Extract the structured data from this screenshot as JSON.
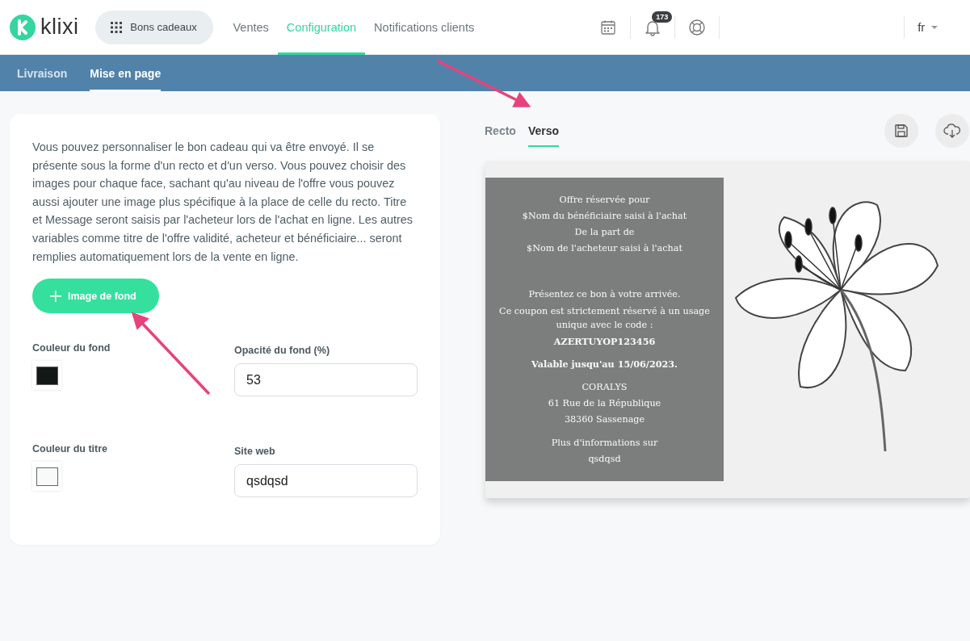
{
  "header": {
    "logo": "klixi",
    "app_switcher": "Bons cadeaux",
    "nav": [
      {
        "label": "Ventes",
        "selected": false
      },
      {
        "label": "Configuration",
        "selected": true
      },
      {
        "label": "Notifications clients",
        "selected": false
      }
    ],
    "notification_count": "173",
    "language": "fr"
  },
  "subnav": [
    {
      "label": "Livraison",
      "selected": false
    },
    {
      "label": "Mise en page",
      "selected": true
    }
  ],
  "settings": {
    "description": "Vous pouvez personnaliser le bon cadeau qui va être envoyé. Il se présente sous la forme d'un recto et d'un verso. Vous pouvez choisir des images pour chaque face, sachant qu'au niveau de l'offre vous pouvez aussi ajouter une image plus spécifique à la place de celle du recto. Titre et Message seront saisis par l'acheteur lors de l'achat en ligne. Les autres variables comme titre de l'offre validité, acheteur et bénéficiaire... seront remplies automatiquement lors de la vente en ligne.",
    "add_button": "Image de fond",
    "fields": [
      {
        "kind": "color",
        "label": "Couleur du fond",
        "color": "#141816"
      },
      {
        "kind": "input",
        "label": "Opacité du fond (%)",
        "value": "53"
      },
      {
        "kind": "color",
        "label": "Couleur du titre",
        "color": "#f8fafa"
      },
      {
        "kind": "input",
        "label": "Site web",
        "value": "qsdqsd"
      }
    ]
  },
  "preview": {
    "tabs": [
      {
        "label": "Recto",
        "selected": false
      },
      {
        "label": "Verso",
        "selected": true
      }
    ],
    "blocks": [
      [
        {
          "text": "Offre réservée pour",
          "bold": false
        },
        {
          "text": "$Nom du bénéficiaire saisi à l'achat",
          "bold": false
        },
        {
          "text": "De la part de",
          "bold": false
        },
        {
          "text": "$Nom de l'acheteur saisi à l'achat",
          "bold": false
        }
      ],
      [
        {
          "text": "Présentez ce bon à votre arrivée.",
          "bold": false
        },
        {
          "text": "Ce coupon est strictement réservé à un usage unique avec le code :",
          "bold": false
        },
        {
          "text": "AZERTUYOP123456",
          "bold": true
        }
      ],
      [
        {
          "text": "Valable jusqu'au 15/06/2023.",
          "bold": true
        }
      ],
      [
        {
          "text": "CORALYS",
          "bold": false
        },
        {
          "text": "61 Rue de la République",
          "bold": false
        },
        {
          "text": "38360 Sassenage",
          "bold": false
        }
      ],
      [
        {
          "text": "Plus d'informations sur",
          "bold": false
        },
        {
          "text": "qsdqsd",
          "bold": false
        }
      ]
    ]
  }
}
